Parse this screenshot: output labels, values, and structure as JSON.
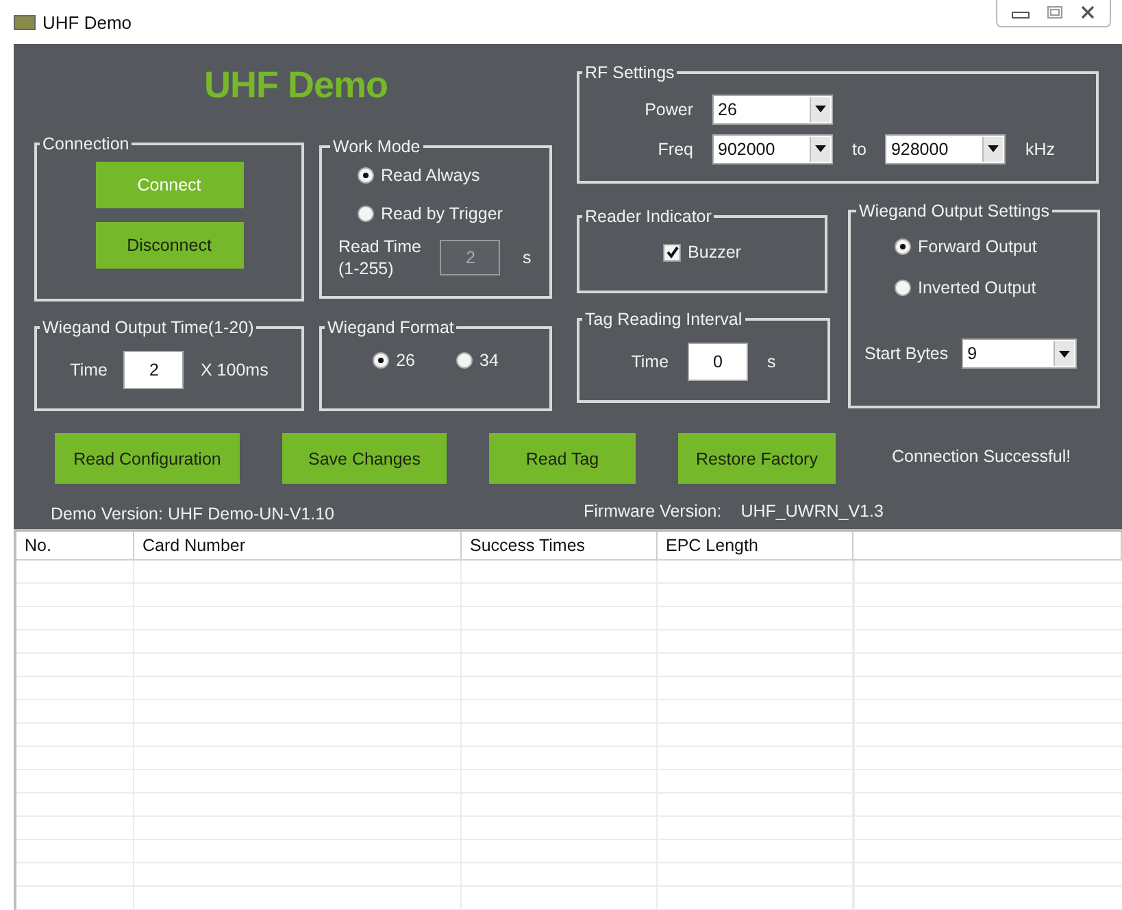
{
  "window": {
    "title": "UHF Demo"
  },
  "app_title": "UHF Demo",
  "connection": {
    "title": "Connection",
    "buttons": [
      {
        "label": "Connect",
        "focused": true
      },
      {
        "label": "Disconnect",
        "focused": false
      }
    ]
  },
  "work_mode": {
    "title": "Work Mode",
    "options": [
      {
        "label": "Read Always",
        "selected": true
      },
      {
        "label": "Read by Trigger",
        "selected": false
      }
    ],
    "read_time_label": "Read Time",
    "read_time_range": "(1-255)",
    "read_time": {
      "value": "2",
      "disabled": true
    },
    "unit": "s"
  },
  "wiegand_output_time": {
    "title": "Wiegand Output Time(1-20)",
    "label": "Time",
    "value": "2",
    "unit": "X 100ms"
  },
  "wiegand_format": {
    "title": "Wiegand Format",
    "options": [
      {
        "label": "26",
        "selected": true
      },
      {
        "label": "34",
        "selected": false
      }
    ]
  },
  "rf_settings": {
    "title": "RF Settings",
    "power_label": "Power",
    "power": "26",
    "freq_label": "Freq",
    "freq_from": "902000",
    "to_label": "to",
    "freq_to": "928000",
    "unit": "kHz"
  },
  "reader_indicator": {
    "title": "Reader Indicator",
    "buzzer": {
      "label": "Buzzer",
      "checked": true
    }
  },
  "tag_reading_interval": {
    "title": "Tag Reading Interval",
    "label": "Time",
    "value": "0",
    "unit": "s"
  },
  "wiegand_output_settings": {
    "title": "Wiegand Output Settings",
    "options": [
      {
        "label": "Forward Output",
        "selected": true
      },
      {
        "label": "Inverted Output",
        "selected": false
      }
    ],
    "start_bytes_label": "Start Bytes",
    "start_bytes": "9"
  },
  "actions": [
    "Read Configuration",
    "Save Changes",
    "Read Tag",
    "Restore Factory"
  ],
  "status": "Connection Successful!",
  "demo_version": "Demo Version: UHF Demo-UN-V1.10",
  "firmware_label": "Firmware Version:",
  "firmware_version": "UHF_UWRN_V1.3",
  "table": {
    "columns": [
      "No.",
      "Card Number",
      "Success Times",
      "EPC Length"
    ]
  }
}
